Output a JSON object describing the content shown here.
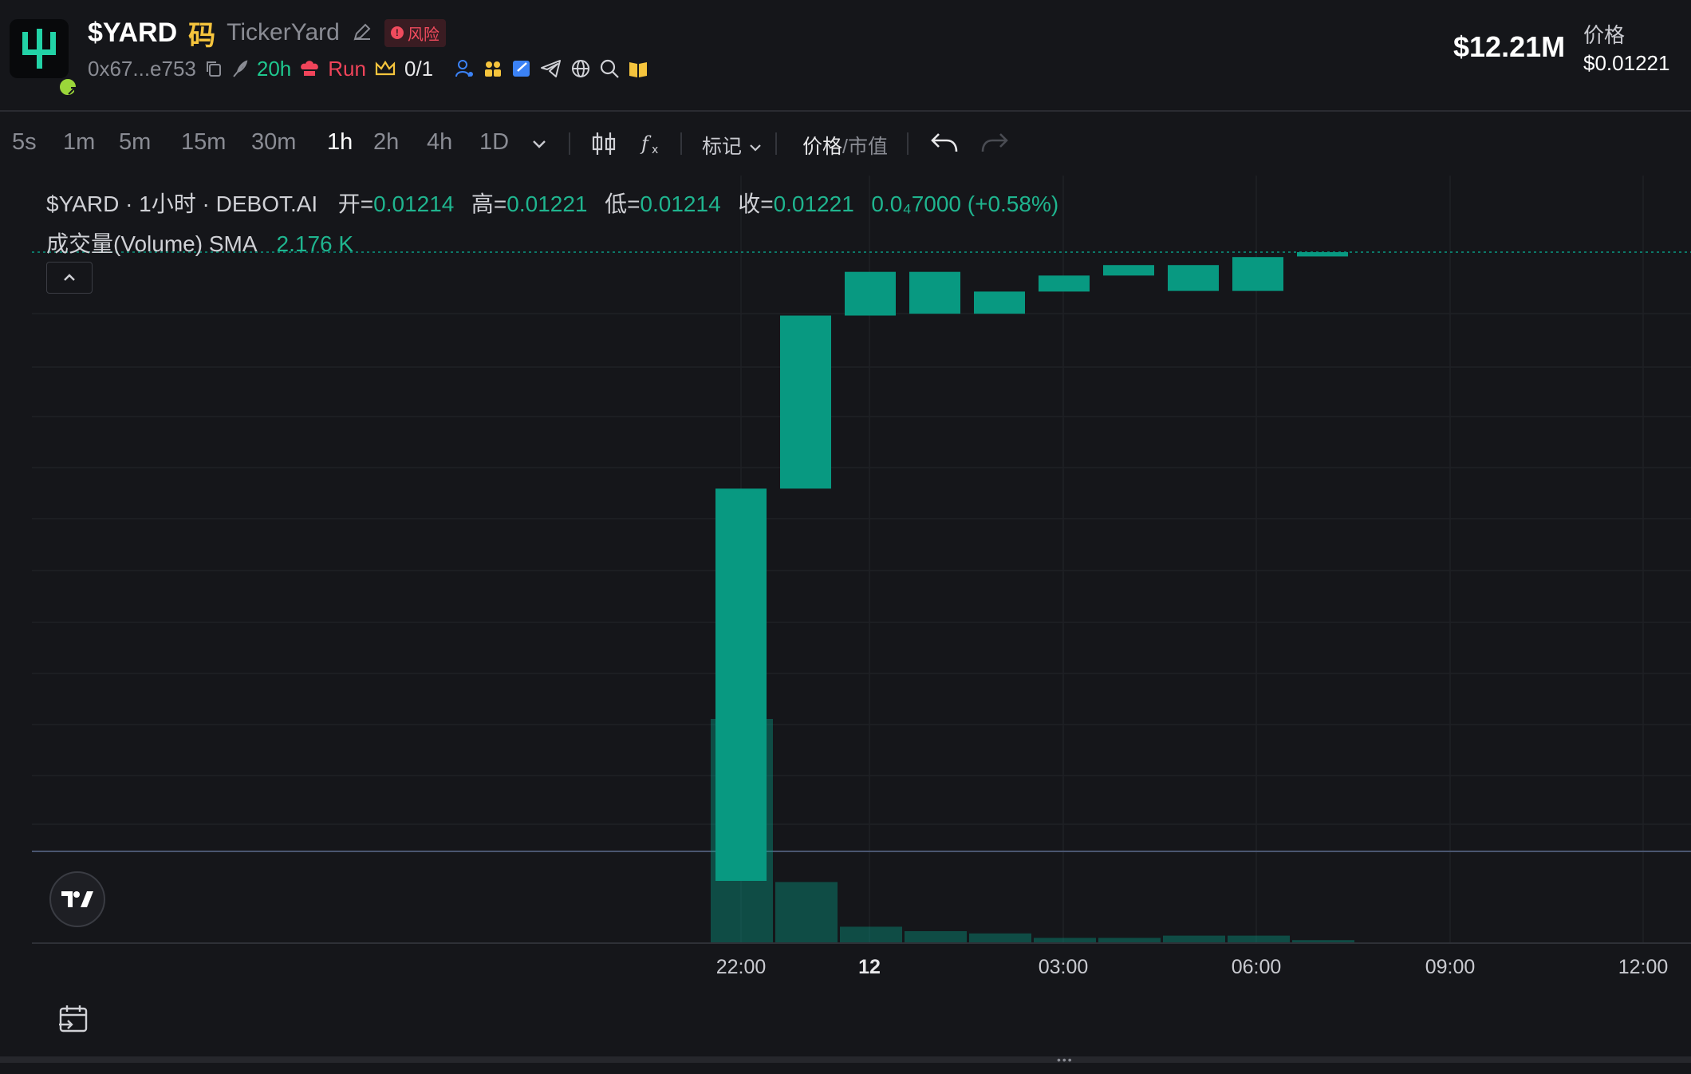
{
  "header": {
    "symbol": "$YARD",
    "glyph": "码",
    "fullname": "TickerYard",
    "risk_label": "风险",
    "address": "0x67...e753",
    "age": "20h",
    "run_label": "Run",
    "holders_ratio": "0/1",
    "market_cap": "$12.21M",
    "price_label": "价格",
    "price_value": "$0.01221"
  },
  "toolbar": {
    "timeframes": [
      "5s",
      "1m",
      "5m",
      "15m",
      "30m",
      "1h",
      "2h",
      "4h",
      "1D"
    ],
    "active_timeframe": "1h",
    "marks_label": "标记",
    "price_label": "价格",
    "slash": "/",
    "mcap_label": "市值"
  },
  "legend": {
    "title": "$YARD · 1小时 · DEBOT.AI",
    "open_label": "开=",
    "open_value": "0.01214",
    "high_label": "高=",
    "high_value": "0.01221",
    "low_label": "低=",
    "low_value": "0.01214",
    "close_label": "收=",
    "close_value": "0.01221",
    "change": "0.0₄7000 (+0.58%)",
    "volume_label": "成交量(Volume) SMA",
    "volume_value": "2.176 K"
  },
  "colors": {
    "up": "#089981",
    "background": "#15161a",
    "accent": "#1fb58f",
    "risk": "#f04b5d"
  },
  "chart_data": {
    "type": "candlestick",
    "x_ticks": [
      "22:00",
      "12",
      "03:00",
      "06:00",
      "09:00",
      "12:00"
    ],
    "current_price_line": "0.01221",
    "candles": [
      {
        "x": "22:00",
        "open": 0.002,
        "close": 0.00837
      },
      {
        "x": "23:00",
        "open": 0.00837,
        "close": 0.01118
      },
      {
        "x": "00:00",
        "open": 0.01118,
        "close": 0.01189
      },
      {
        "x": "01:00",
        "open": 0.01189,
        "close": 0.01121
      },
      {
        "x": "02:00",
        "open": 0.01121,
        "close": 0.01157
      },
      {
        "x": "03:00",
        "open": 0.01157,
        "close": 0.01183
      },
      {
        "x": "04:00",
        "open": 0.01183,
        "close": 0.012
      },
      {
        "x": "05:00",
        "open": 0.012,
        "close": 0.01158
      },
      {
        "x": "06:00",
        "open": 0.01158,
        "close": 0.01213
      },
      {
        "x": "07:00",
        "open": 0.01214,
        "close": 0.01221
      }
    ],
    "volume": [
      100,
      27,
      7,
      5,
      4,
      2,
      2,
      3,
      3,
      1
    ]
  }
}
